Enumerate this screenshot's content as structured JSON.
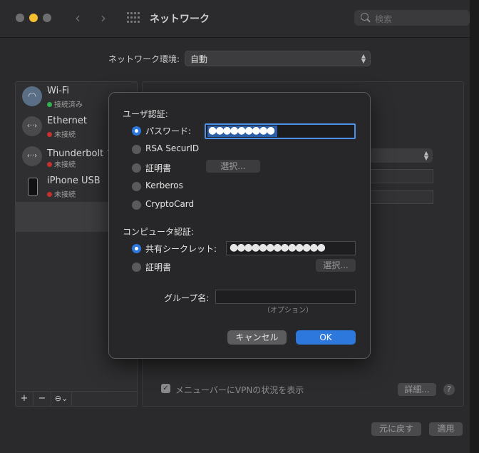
{
  "window": {
    "title": "ネットワーク"
  },
  "toolbar": {
    "back_glyph": "‹",
    "forward_glyph": "›",
    "search_placeholder": "検索"
  },
  "location": {
    "label": "ネットワーク環境:",
    "value": "自動"
  },
  "sidebar": {
    "items": [
      {
        "name": "Wi-Fi",
        "status": "接続済み",
        "status_color": "#2fb24c",
        "icon": "wifi-icon"
      },
      {
        "name": "Ethernet",
        "status": "未接続",
        "status_color": "#c8302d",
        "icon": "ethernet-icon"
      },
      {
        "name": "Thunderbolt ブ",
        "status": "未接続",
        "status_color": "#c8302d",
        "icon": "thunderbolt-icon"
      },
      {
        "name": "iPhone USB",
        "status": "未接続",
        "status_color": "#c8302d",
        "icon": "iphone-icon"
      }
    ],
    "add_label": "+",
    "remove_label": "−",
    "action_label": "⊖⌄"
  },
  "right_pane": {
    "vpn_menu_label": "メニューバーにVPNの状況を表示",
    "details_label": "詳細...",
    "help_label": "?",
    "revert_label": "元に戻す",
    "apply_label": "適用"
  },
  "dialog": {
    "user_auth": {
      "heading": "ユーザ認証:",
      "selected": "パスワード",
      "options": [
        "パスワード:",
        "RSA SecurID",
        "証明書",
        "Kerberos",
        "CryptoCard"
      ],
      "password_value": "●●●●●●●●●",
      "select_button": "選択..."
    },
    "machine_auth": {
      "heading": "コンピュータ認証:",
      "selected": "共有シークレット",
      "options": [
        "共有シークレット:",
        "証明書"
      ],
      "secret_value": "●●●●●●●●●●●●●",
      "select_button": "選択..."
    },
    "group": {
      "label": "グループ名:",
      "value": "",
      "hint": "（オプション）"
    },
    "cancel_label": "キャンセル",
    "ok_label": "OK"
  },
  "colors": {
    "accent": "#2c78dc",
    "connected": "#2fb24c",
    "disconnected": "#c8302d"
  }
}
